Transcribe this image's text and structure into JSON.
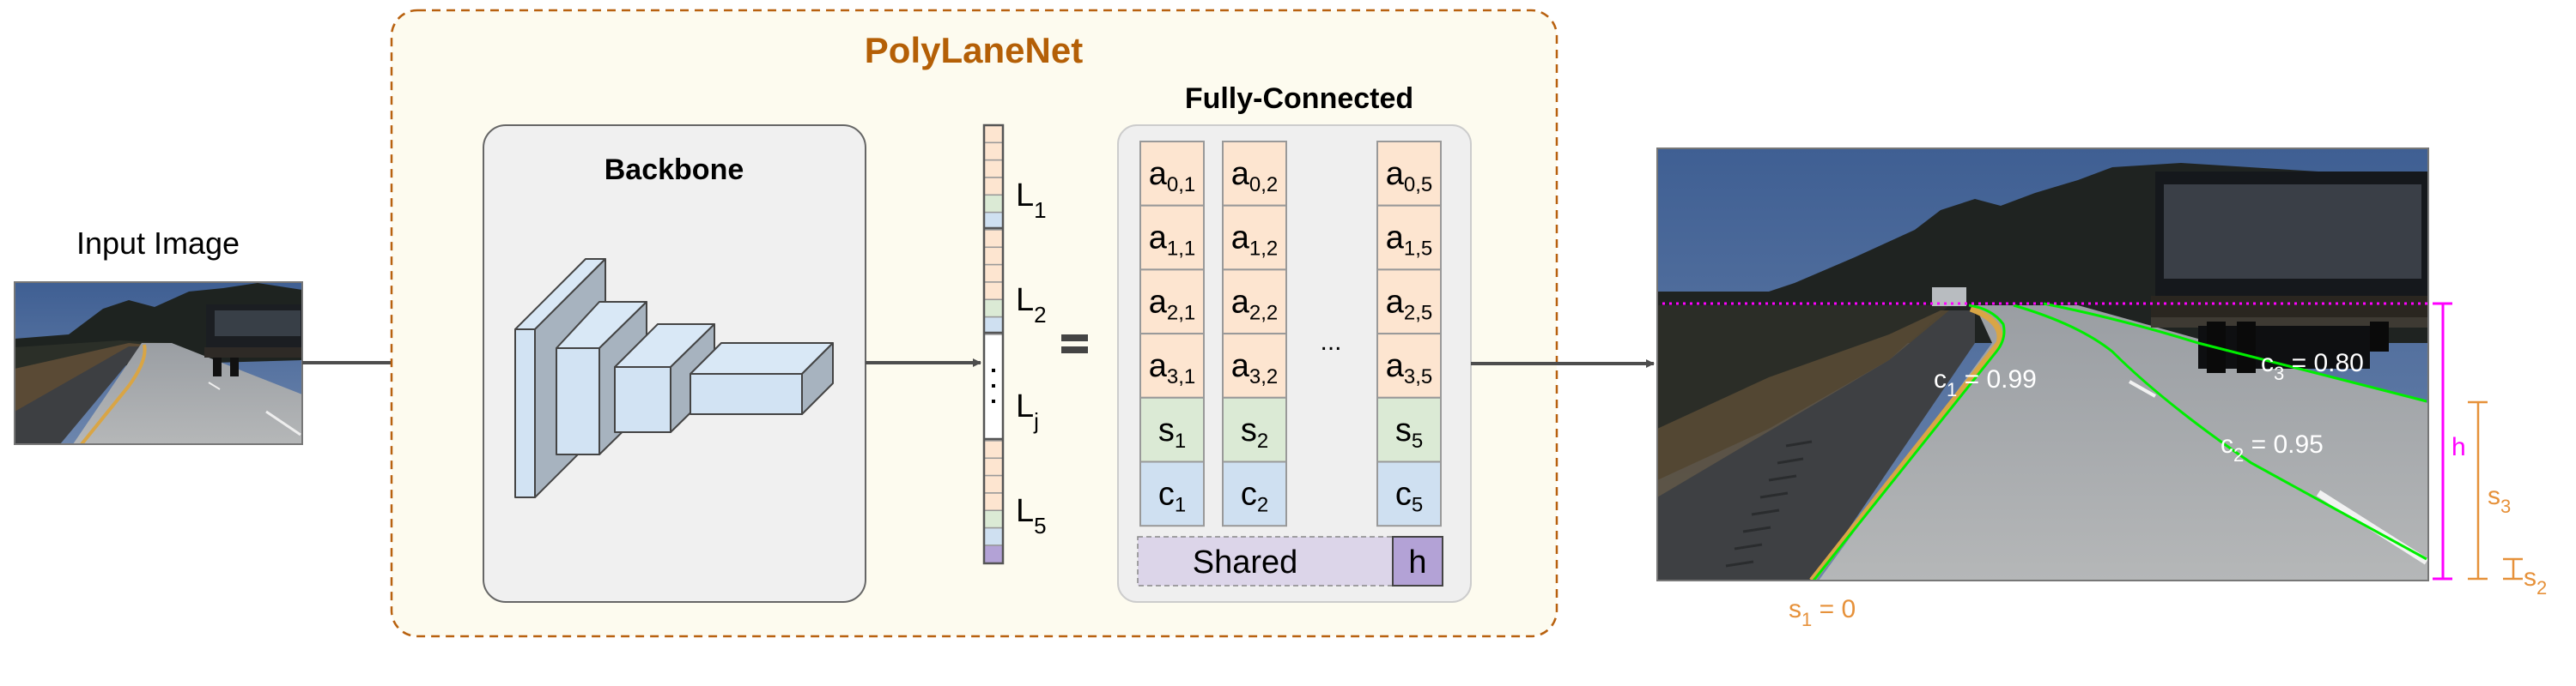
{
  "input": {
    "title": "Input Image"
  },
  "model": {
    "title": "PolyLaneNet",
    "backbone_title": "Backbone",
    "fc_title": "Fully-Connected",
    "shared_label": "Shared",
    "h_label": "h",
    "equals": "=",
    "ellipsis": "...",
    "vector_dots": ":",
    "vector_labels": [
      {
        "base": "L",
        "sub": "1"
      },
      {
        "base": "L",
        "sub": "2"
      },
      {
        "base": "L",
        "sub": "j"
      },
      {
        "base": "L",
        "sub": "5"
      }
    ],
    "fc_columns": [
      {
        "cells": [
          {
            "base": "a",
            "sub": "0,1",
            "kind": "coef"
          },
          {
            "base": "a",
            "sub": "1,1",
            "kind": "coef"
          },
          {
            "base": "a",
            "sub": "2,1",
            "kind": "coef"
          },
          {
            "base": "a",
            "sub": "3,1",
            "kind": "coef"
          },
          {
            "base": "s",
            "sub": "1",
            "kind": "start"
          },
          {
            "base": "c",
            "sub": "1",
            "kind": "conf"
          }
        ]
      },
      {
        "cells": [
          {
            "base": "a",
            "sub": "0,2",
            "kind": "coef"
          },
          {
            "base": "a",
            "sub": "1,2",
            "kind": "coef"
          },
          {
            "base": "a",
            "sub": "2,2",
            "kind": "coef"
          },
          {
            "base": "a",
            "sub": "3,2",
            "kind": "coef"
          },
          {
            "base": "s",
            "sub": "2",
            "kind": "start"
          },
          {
            "base": "c",
            "sub": "2",
            "kind": "conf"
          }
        ]
      },
      {
        "cells": [
          {
            "base": "a",
            "sub": "0,5",
            "kind": "coef"
          },
          {
            "base": "a",
            "sub": "1,5",
            "kind": "coef"
          },
          {
            "base": "a",
            "sub": "2,5",
            "kind": "coef"
          },
          {
            "base": "a",
            "sub": "3,5",
            "kind": "coef"
          },
          {
            "base": "s",
            "sub": "5",
            "kind": "start"
          },
          {
            "base": "c",
            "sub": "5",
            "kind": "conf"
          }
        ]
      }
    ]
  },
  "output": {
    "lanes": [
      {
        "label_base": "c",
        "label_sub": "1",
        "label_value": " = 0.99"
      },
      {
        "label_base": "c",
        "label_sub": "2",
        "label_value": " = 0.95"
      },
      {
        "label_base": "c",
        "label_sub": "3",
        "label_value": " = 0.80"
      }
    ],
    "h_label": "h",
    "s3_label": {
      "base": "s",
      "sub": "3"
    },
    "s2_label": {
      "base": "s",
      "sub": "2"
    },
    "s1_label": {
      "base": "s",
      "sub": "1",
      "value": " = 0"
    }
  },
  "colors": {
    "model_border": "#b8610f",
    "model_title": "#b45f06",
    "model_bg": "#fdfbef",
    "box_bg": "#f0f0f0",
    "box_border": "#666666",
    "coef": "#fde5d0",
    "start": "#dbead5",
    "conf": "#cfe0f1",
    "shared": "#dcd5e9",
    "h": "#b3a2d6",
    "cube_front": "#d4e4f4",
    "cube_side": "#a7b3bf",
    "arrow": "#4d4d4d",
    "magenta": "#ff00ff",
    "orange": "#e6913a",
    "lane": "#00ee00"
  }
}
